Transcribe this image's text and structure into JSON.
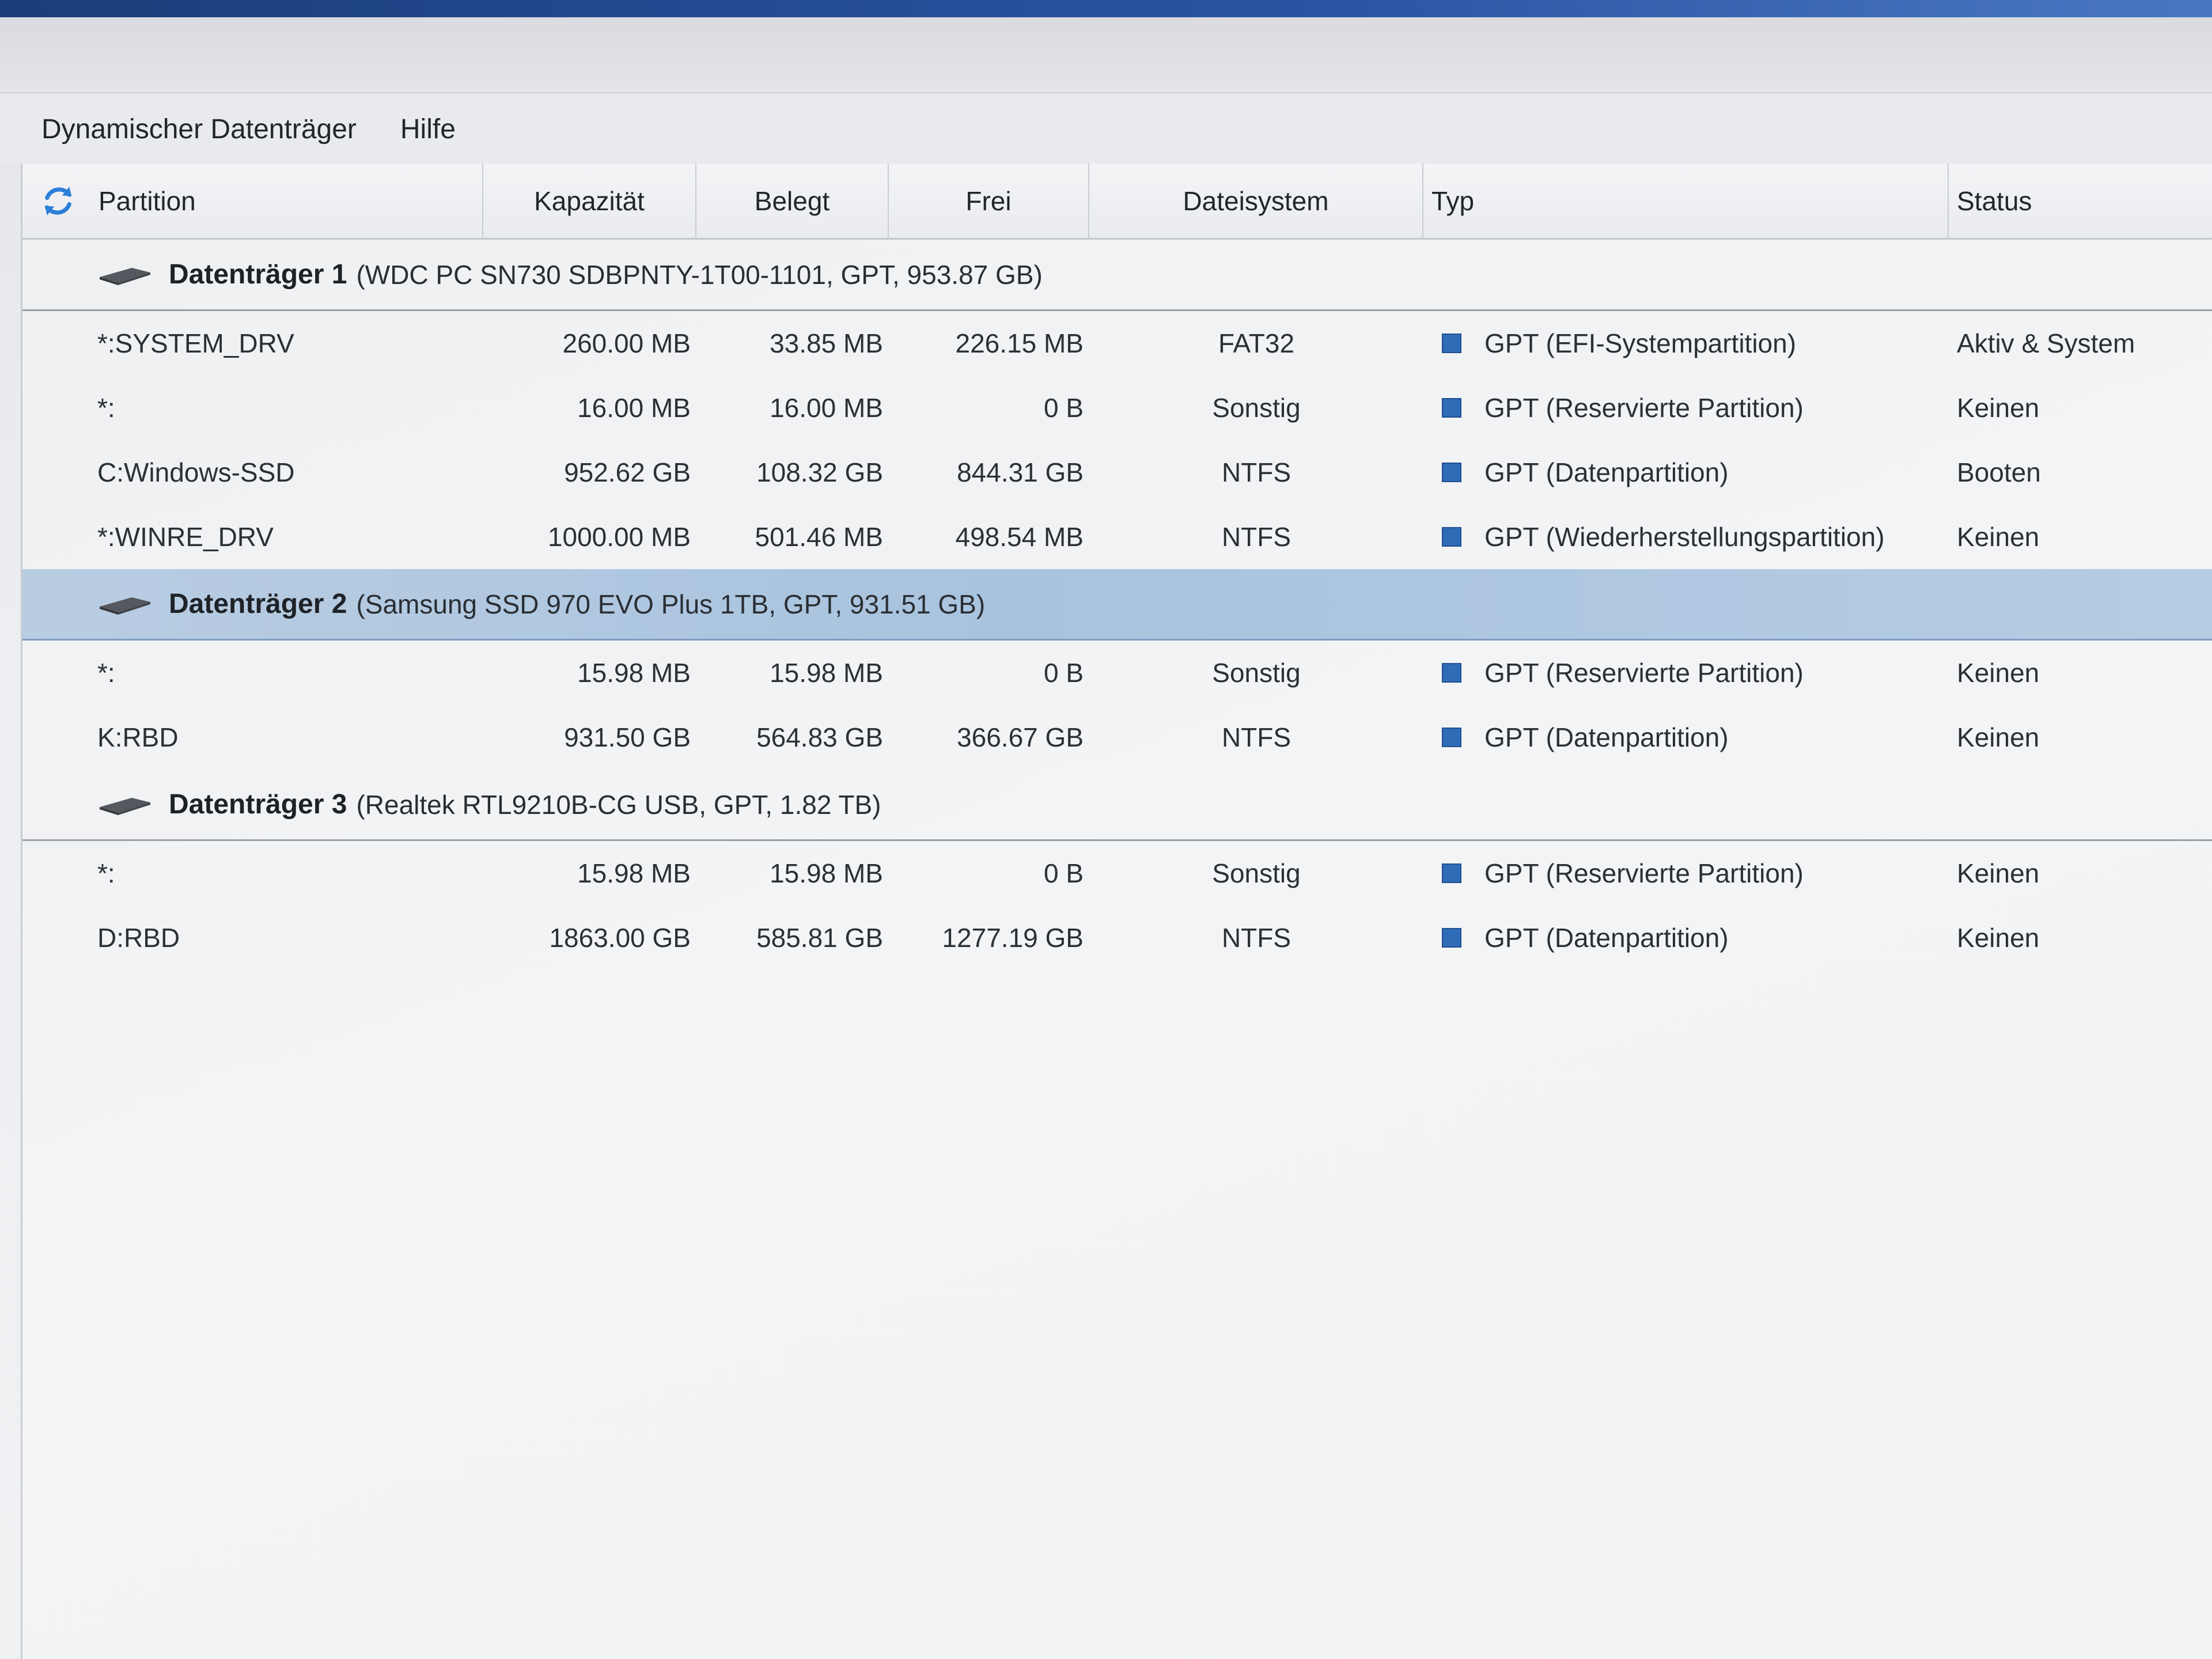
{
  "menu": {
    "items": [
      "Dynamischer Datenträger",
      "Hilfe"
    ]
  },
  "columns": {
    "partition": "Partition",
    "kapazitaet": "Kapazität",
    "belegt": "Belegt",
    "frei": "Frei",
    "dateisystem": "Dateisystem",
    "typ": "Typ",
    "status": "Status"
  },
  "icons": {
    "refresh": "refresh-icon",
    "disk": "disk-icon",
    "partition_type": "partition-type-square-icon"
  },
  "colors": {
    "accent": "#2f6cb8",
    "selected_row": "#a8c3de"
  },
  "disks": [
    {
      "title": "Datenträger 1",
      "detail": "(WDC PC SN730 SDBPNTY-1T00-1101, GPT, 953.87 GB)",
      "selected": false,
      "partitions": [
        {
          "name": "*:SYSTEM_DRV",
          "kapazitaet": "260.00 MB",
          "belegt": "33.85 MB",
          "frei": "226.15 MB",
          "dateisystem": "FAT32",
          "typ": "GPT (EFI-Systempartition)",
          "status": "Aktiv & System"
        },
        {
          "name": "*:",
          "kapazitaet": "16.00 MB",
          "belegt": "16.00 MB",
          "frei": "0 B",
          "dateisystem": "Sonstig",
          "typ": "GPT (Reservierte Partition)",
          "status": "Keinen"
        },
        {
          "name": "C:Windows-SSD",
          "kapazitaet": "952.62 GB",
          "belegt": "108.32 GB",
          "frei": "844.31 GB",
          "dateisystem": "NTFS",
          "typ": "GPT (Datenpartition)",
          "status": "Booten"
        },
        {
          "name": "*:WINRE_DRV",
          "kapazitaet": "1000.00 MB",
          "belegt": "501.46 MB",
          "frei": "498.54 MB",
          "dateisystem": "NTFS",
          "typ": "GPT (Wiederherstellungspartition)",
          "status": "Keinen"
        }
      ]
    },
    {
      "title": "Datenträger 2",
      "detail": "(Samsung SSD 970 EVO Plus 1TB, GPT, 931.51 GB)",
      "selected": true,
      "partitions": [
        {
          "name": "*:",
          "kapazitaet": "15.98 MB",
          "belegt": "15.98 MB",
          "frei": "0 B",
          "dateisystem": "Sonstig",
          "typ": "GPT (Reservierte Partition)",
          "status": "Keinen"
        },
        {
          "name": "K:RBD",
          "kapazitaet": "931.50 GB",
          "belegt": "564.83 GB",
          "frei": "366.67 GB",
          "dateisystem": "NTFS",
          "typ": "GPT (Datenpartition)",
          "status": "Keinen"
        }
      ]
    },
    {
      "title": "Datenträger 3",
      "detail": "(Realtek RTL9210B-CG USB, GPT, 1.82 TB)",
      "selected": false,
      "partitions": [
        {
          "name": "*:",
          "kapazitaet": "15.98 MB",
          "belegt": "15.98 MB",
          "frei": "0 B",
          "dateisystem": "Sonstig",
          "typ": "GPT (Reservierte Partition)",
          "status": "Keinen"
        },
        {
          "name": "D:RBD",
          "kapazitaet": "1863.00 GB",
          "belegt": "585.81 GB",
          "frei": "1277.19 GB",
          "dateisystem": "NTFS",
          "typ": "GPT (Datenpartition)",
          "status": "Keinen"
        }
      ]
    }
  ]
}
